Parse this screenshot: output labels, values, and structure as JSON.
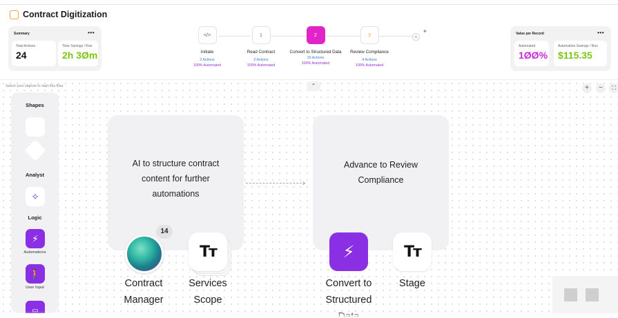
{
  "page": {
    "title": "Contract Digitization",
    "accent": "#f2a33a"
  },
  "summary": {
    "title": "Summary",
    "menu": "•••",
    "total_actions_label": "Total Actions",
    "total_actions_value": "24",
    "time_savings_label": "Time Savings / Run",
    "time_savings_value": "2h 3Øm"
  },
  "value_per_record": {
    "title": "Value per Record",
    "menu": "•••",
    "automated_label": "Automated",
    "automated_value": "1ØØ%",
    "savings_label": "Automation Savings / Run",
    "savings_value": "$115.35"
  },
  "steps": [
    {
      "badge": "</>",
      "name": "Initiate",
      "actions": "2 Actions",
      "automated": "100% Automated",
      "active": false
    },
    {
      "badge": "1",
      "name": "Read Contract",
      "actions": "3 Actions",
      "automated": "100% Automated",
      "active": false
    },
    {
      "badge": "2",
      "name": "Convert to Structured Data",
      "actions": "15 Actions",
      "automated": "100% Automated",
      "active": true
    },
    {
      "badge": "3",
      "name": "Review Compliance",
      "actions": "4 Actions",
      "automated": "100% Automated",
      "active": false
    }
  ],
  "toolbar": {
    "add_step": "+",
    "magic": "✦",
    "collapse": "⌃"
  },
  "canvas": {
    "hint": "Select your objects to start this flow.",
    "zoom_in": "+",
    "zoom_out": "−",
    "fit": "⛶"
  },
  "palette": {
    "shapes_heading": "Shapes",
    "analyst_heading": "Analyst",
    "logic_heading": "Logic",
    "automations_label": "Automations",
    "user_input_label": "User Input"
  },
  "nodes": {
    "card_left_text": "AI to structure contract content for further automations",
    "card_right_text": "Advance to Review Compliance",
    "contract_manager_label": "Contract Manager",
    "contract_manager_badge": "14",
    "services_scope_label": "Services Scope",
    "convert_label": "Convert to Structured Data",
    "stage_label": "Stage"
  },
  "colors": {
    "purple": "#8a2fe3",
    "magenta": "#e024c8",
    "blue": "#3a7bd5",
    "orange": "#f2a33a",
    "green": "#7cc614",
    "violet": "#9b2fcf"
  }
}
